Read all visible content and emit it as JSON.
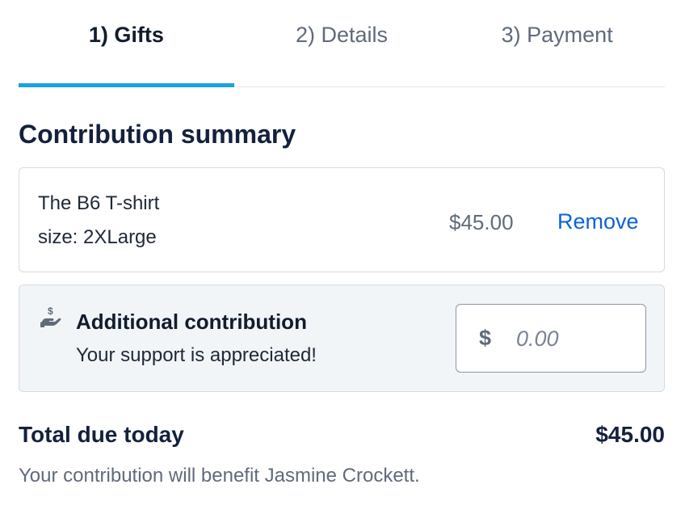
{
  "tabs": [
    {
      "label": "1) Gifts",
      "active": true
    },
    {
      "label": "2) Details",
      "active": false
    },
    {
      "label": "3) Payment",
      "active": false
    }
  ],
  "summary": {
    "title": "Contribution summary",
    "item": {
      "name": "The B6 T-shirt",
      "size": "size: 2XLarge",
      "price": "$45.00",
      "remove_label": "Remove"
    }
  },
  "additional": {
    "icon": "hand-dollar-icon",
    "title": "Additional contribution",
    "subtitle": "Your support is appreciated!",
    "currency_symbol": "$",
    "amount_placeholder": "0.00",
    "amount_value": ""
  },
  "total": {
    "label": "Total due today",
    "value": "$45.00"
  },
  "note": "Your contribution will benefit Jasmine Crockett.",
  "colors": {
    "accent": "#1ba2df",
    "link": "#0d62d8",
    "heading": "#14213d",
    "muted": "#5f6b7a"
  }
}
